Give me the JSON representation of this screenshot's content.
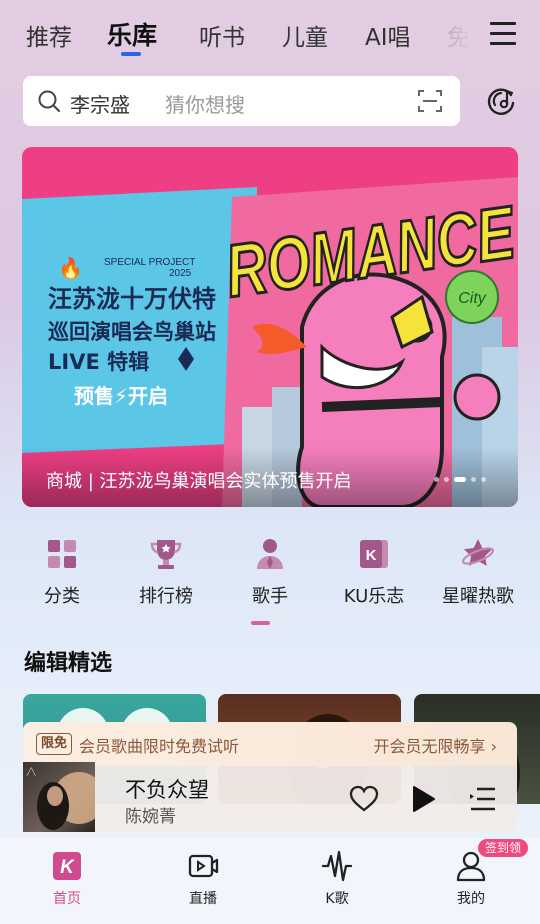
{
  "tabs": [
    {
      "label": "推荐",
      "active": false
    },
    {
      "label": "乐库",
      "active": true
    },
    {
      "label": "听书",
      "active": false
    },
    {
      "label": "儿童",
      "active": false
    },
    {
      "label": "AI唱",
      "active": false
    },
    {
      "label": "免",
      "active": false
    }
  ],
  "search": {
    "keyword": "李宗盛",
    "hint": "猜你想搜"
  },
  "banner": {
    "special_project": "SPECIAL PROJECT",
    "year": "2025",
    "headline_line1": "汪苏泷十万伏特",
    "headline_line2": "巡回演唱会鸟巢站",
    "headline_line3": "LIVE  特辑",
    "presale": "预售⚡开启",
    "romance": "ROMANCE",
    "city_badge": "City",
    "caption": "商城 | 汪苏泷鸟巢演唱会实体预售开启",
    "slide_count": 5,
    "active_slide": 2
  },
  "categories": [
    {
      "label": "分类",
      "icon": "grid-icon"
    },
    {
      "label": "排行榜",
      "icon": "trophy-icon"
    },
    {
      "label": "歌手",
      "icon": "singer-icon"
    },
    {
      "label": "KU乐志",
      "icon": "ku-magazine-icon"
    },
    {
      "label": "星曜热歌",
      "icon": "star-icon"
    }
  ],
  "category_page": {
    "current": 1,
    "total": 2
  },
  "section": {
    "title": "编辑精选"
  },
  "membership": {
    "tag": "限免",
    "text": "会员歌曲限时免费试听",
    "cta": "开会员无限畅享 ›"
  },
  "player": {
    "title": "不负众望",
    "artist": "陈婉菁"
  },
  "bottom_nav": [
    {
      "label": "首页",
      "icon": "home-k-icon",
      "active": true
    },
    {
      "label": "直播",
      "icon": "live-icon",
      "active": false
    },
    {
      "label": "K歌",
      "icon": "k-song-icon",
      "active": false
    },
    {
      "label": "我的",
      "icon": "profile-icon",
      "active": false
    }
  ],
  "badges": {
    "signin": "签到领"
  },
  "colors": {
    "accent_pink": "#d04a8e",
    "tab_underline": "#2a65e8",
    "banner_pink": "#ee3f85",
    "banner_cyan": "#5cc6e6",
    "romance_yellow": "#f5e23a"
  }
}
